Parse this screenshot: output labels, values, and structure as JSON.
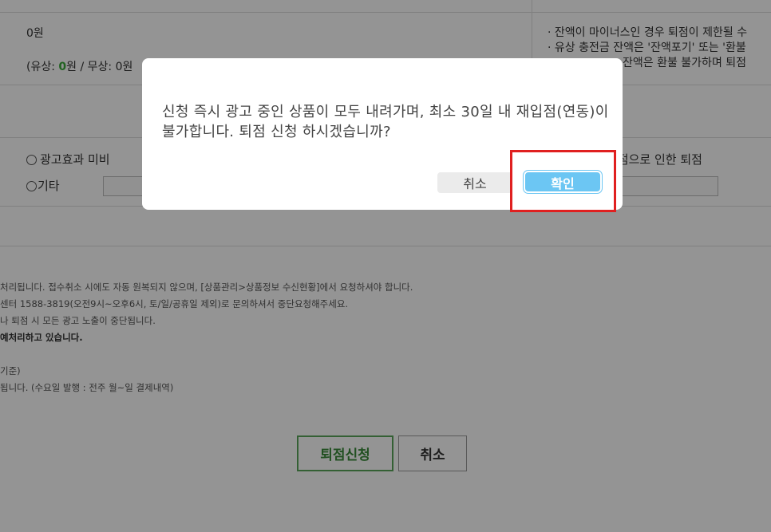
{
  "background": {
    "balance_amount": "0원",
    "balance_detail": {
      "prefix": "(유상: ",
      "paid_value": "0",
      "middle": "원 / 무상: 0원"
    },
    "notes_right": [
      "· 잔액이 마이너스인 경우 퇴점이 제한될 수",
      "· 유상 충전금 잔액은 '잔액포기' 또는 '환불",
      "잔액은 환불 불가하며 퇴점"
    ],
    "reasons": {
      "reason_1": "광고효과 미비",
      "reason_etc": "기타",
      "reason_right": "퇴점으로 인한 퇴점"
    },
    "guide_lines": [
      "처리됩니다. 접수취소 시에도 자동 원복되지 않으며, [상품관리>상품정보 수신현황]에서 요청하셔야 합니다.",
      "센터 1588-3819(오전9시~오후6시, 토/일/공휴일 제외)로 문의하셔서 중단요청해주세요.",
      "나 퇴점 시 모든 광고 노출이 중단됩니다.",
      "예처리하고 있습니다.",
      "",
      "기준)",
      "됩니다. (수요일 발행 : 전주 월~일 결제내역)"
    ],
    "apply_button": "퇴점신청",
    "cancel_button": "취소"
  },
  "modal": {
    "message": "신청 즉시 광고 중인 상품이 모두 내려가며, 최소 30일 내 재입점(연동)이 불가합니다. 퇴점 신청 하시겠습니까?",
    "cancel_label": "취소",
    "confirm_label": "확인"
  },
  "colors": {
    "confirm_button": "#6cc6f3",
    "apply_button_border": "#5aa65a",
    "highlight": "#e02020",
    "paid_value": "#3aa93a"
  }
}
